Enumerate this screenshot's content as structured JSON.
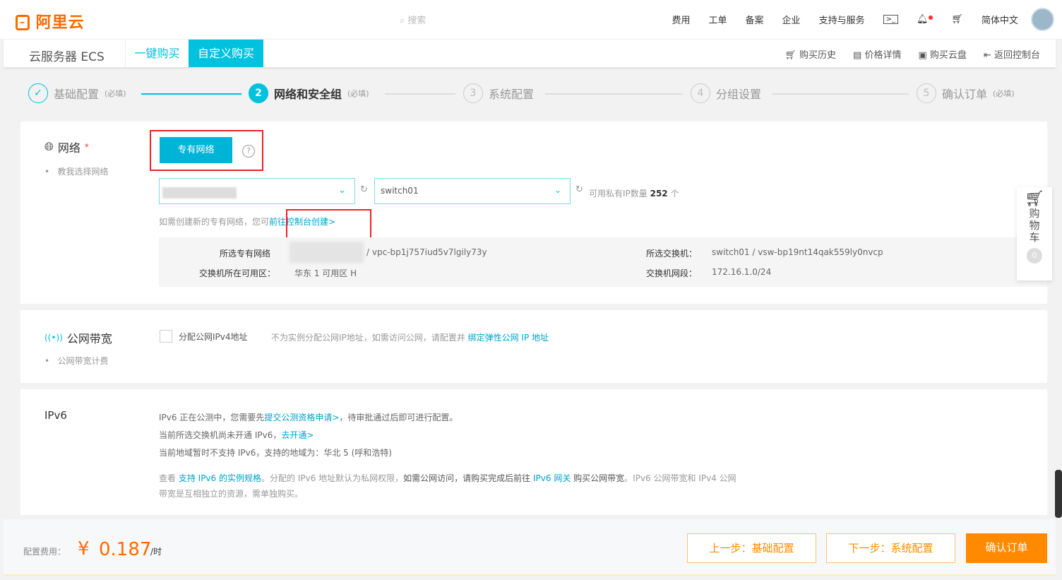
{
  "header": {
    "logo": "阿里云",
    "search_placeholder": "搜索",
    "nav": [
      "费用",
      "工单",
      "备案",
      "企业",
      "支持与服务"
    ],
    "language": "简体中文"
  },
  "subheader": {
    "product": "云服务器 ECS",
    "tabs": [
      "一键购买",
      "自定义购买"
    ],
    "links": [
      "购买历史",
      "价格详情",
      "购买云盘",
      "返回控制台"
    ]
  },
  "steps": [
    {
      "num": "✓",
      "label": "基础配置",
      "req": "(必填)"
    },
    {
      "num": "2",
      "label": "网络和安全组",
      "req": "(必填)"
    },
    {
      "num": "3",
      "label": "系统配置",
      "req": ""
    },
    {
      "num": "4",
      "label": "分组设置",
      "req": ""
    },
    {
      "num": "5",
      "label": "确认订单",
      "req": "(必填)"
    }
  ],
  "network": {
    "title": "网络",
    "star": "*",
    "hint": "教我选择网络",
    "vpc_button": "专有网络",
    "switch_value": "switch01",
    "ip_label": "可用私有IP数量",
    "ip_count": "252",
    "ip_unit": "个",
    "create_text": "如需创建新的专有网络，您可",
    "create_link": "前往控制台创建>",
    "info": {
      "vpc_label": "所选专有网络",
      "vpc_id": "/ vpc-bp1j757iud5v7lgily73y",
      "zone_label": "交换机所在可用区：",
      "zone": "华东 1 可用区 H",
      "switch_label": "所选交换机：",
      "switch": "switch01 / vsw-bp19nt14qak559ly0nvcp",
      "cidr_label": "交换机网段：",
      "cidr": "172.16.1.0/24"
    }
  },
  "bandwidth": {
    "title": "公网带宽",
    "hint": "公网带宽计费",
    "checkbox_label": "分配公网IPv4地址",
    "desc": "不为实例分配公网IP地址，如需访问公网，请配置并",
    "link": "绑定弹性公网 IP 地址"
  },
  "ipv6": {
    "title": "IPv6",
    "l1a": "IPv6 正在公测中，您需要先",
    "l1link": "提交公测资格申请>",
    "l1b": "，待审批通过后即可进行配置。",
    "l2a": "当前所选交换机尚未开通 IPv6，",
    "l2link": "去开通>",
    "l3": "当前地域暂时不支持 IPv6，支持的地域为：华北 5 (呼和浩特)",
    "l4a": "查看",
    "l4link1": "支持 IPv6 的实例规格",
    "l4b": "。分配的 IPv6 地址默认为私网权限，",
    "l4c": "如需公网访问，请购买完成后前往",
    "l4link2": "IPv6 网关",
    "l4d": "购买公网带宽",
    "l4e": "。IPv6 公网带宽和 IPv4 公网",
    "l5": "带宽是互相独立的资源，需单独购买。"
  },
  "cart": {
    "label": "购物车",
    "count": "0"
  },
  "footer": {
    "fee_label": "配置费用：",
    "currency": "¥",
    "price": "0.187",
    "unit": "/时",
    "prev": "上一步：基础配置",
    "next": "下一步：系统配置",
    "confirm": "确认订单"
  }
}
